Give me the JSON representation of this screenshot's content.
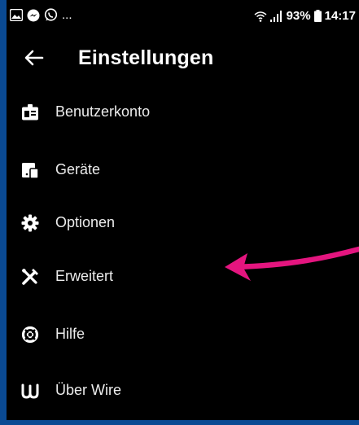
{
  "status_bar": {
    "left_icons": [
      "gallery-icon",
      "messenger-icon",
      "whatsapp-icon"
    ],
    "left_more": "...",
    "right_icons": [
      "wifi-icon",
      "signal-icon"
    ],
    "battery": "93%",
    "time": "14:17"
  },
  "toolbar": {
    "title": "Einstellungen",
    "back_icon": "arrow-left-icon"
  },
  "menu": {
    "items": [
      {
        "label": "Benutzerkonto",
        "icon": "id-badge-icon"
      },
      {
        "label": "Geräte",
        "icon": "devices-icon"
      },
      {
        "label": "Optionen",
        "icon": "gear-icon"
      },
      {
        "label": "Erweitert",
        "icon": "tools-icon"
      },
      {
        "label": "Hilfe",
        "icon": "lifebuoy-icon"
      },
      {
        "label": "Über Wire",
        "icon": "wire-logo-icon"
      }
    ]
  },
  "colors": {
    "background": "#000000",
    "frame": "#0a4a93",
    "annotation_arrow": "#e4157f"
  },
  "annotation": {
    "icon": "pointer-arrow-icon",
    "target": "Erweitert"
  }
}
